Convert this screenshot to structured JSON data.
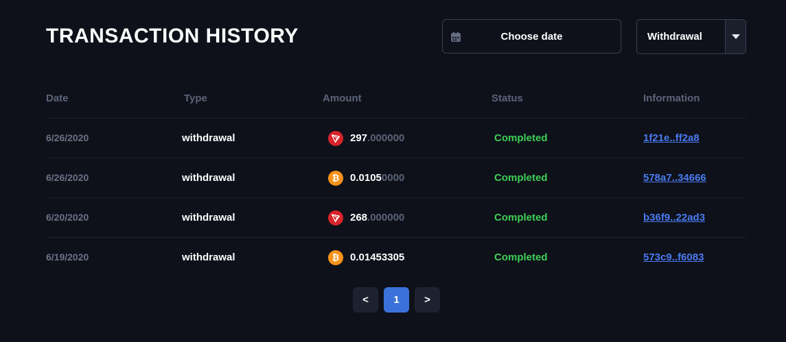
{
  "title": "TRANSACTION HISTORY",
  "filters": {
    "date_label": "Choose date",
    "type_value": "Withdrawal"
  },
  "columns": {
    "date": "Date",
    "type": "Type",
    "amount": "Amount",
    "status": "Status",
    "information": "Information"
  },
  "rows": [
    {
      "date": "6/26/2020",
      "type": "withdrawal",
      "coin": "tron-icon",
      "amount_main": "297",
      "amount_dim": ".000000",
      "status": "Completed",
      "info": "1f21e..ff2a8"
    },
    {
      "date": "6/26/2020",
      "type": "withdrawal",
      "coin": "bitcoin-icon",
      "amount_main": "0.0105",
      "amount_dim": "0000",
      "status": "Completed",
      "info": "578a7..34666"
    },
    {
      "date": "6/20/2020",
      "type": "withdrawal",
      "coin": "tron-icon",
      "amount_main": "268",
      "amount_dim": ".000000",
      "status": "Completed",
      "info": "b36f9..22ad3"
    },
    {
      "date": "6/19/2020",
      "type": "withdrawal",
      "coin": "bitcoin-icon",
      "amount_main": "0.01453305",
      "amount_dim": "",
      "status": "Completed",
      "info": "573c9..f6083"
    }
  ],
  "pagination": {
    "prev": "<",
    "current": "1",
    "next": ">"
  },
  "colors": {
    "background": "#0e111a",
    "status_completed": "#3fcf56",
    "link": "#4a7bf0",
    "active_page": "#3b72d9",
    "tron": "#d8232a",
    "bitcoin": "#f7931a"
  }
}
